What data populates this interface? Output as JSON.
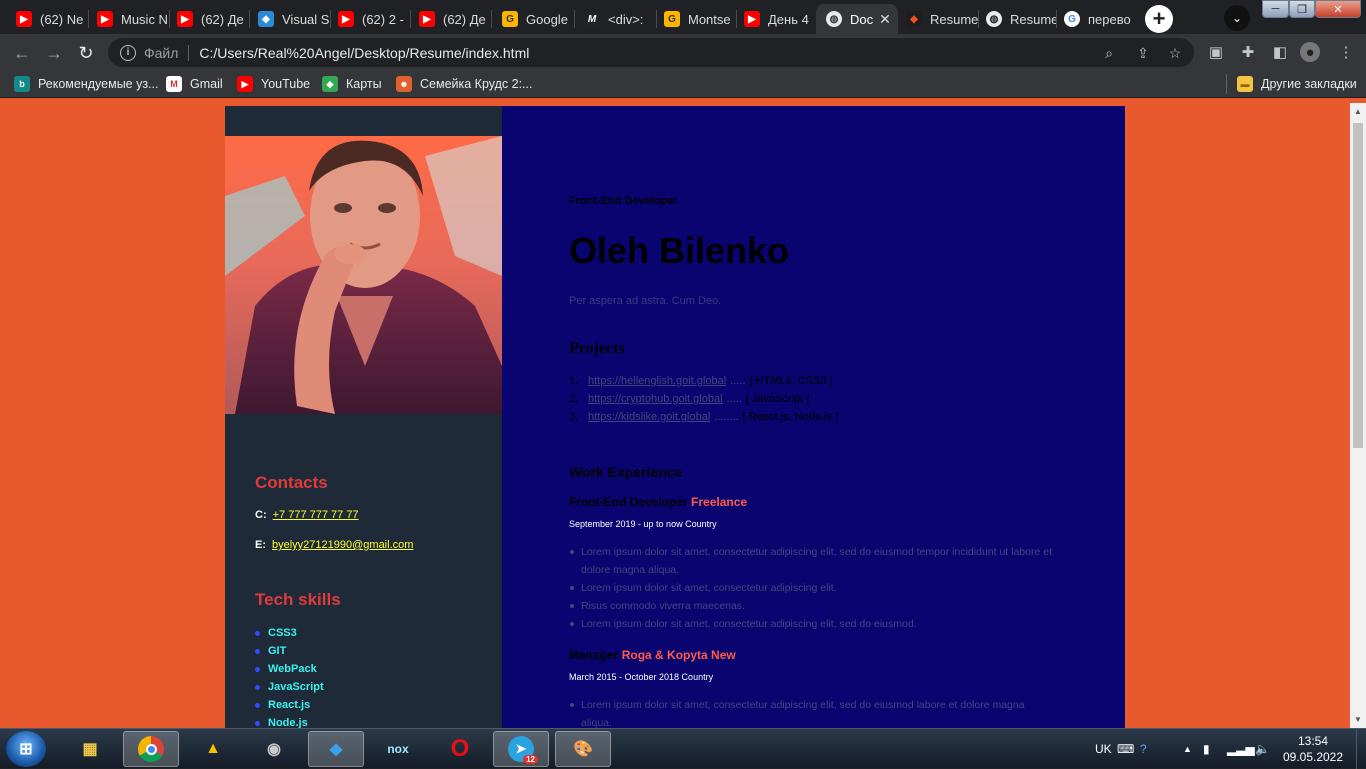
{
  "browser": {
    "tabs": [
      {
        "label": "(62) Ne",
        "icon": "youtube-icon"
      },
      {
        "label": "Music N",
        "icon": "youtube-icon"
      },
      {
        "label": "(62) Де",
        "icon": "youtube-icon"
      },
      {
        "label": "Visual S",
        "icon": "vscode-icon"
      },
      {
        "label": "(62) 2 -",
        "icon": "youtube-icon"
      },
      {
        "label": "(62) Де",
        "icon": "youtube-icon"
      },
      {
        "label": "Google",
        "icon": "goit-icon"
      },
      {
        "label": "<div>: ",
        "icon": "mdn-icon"
      },
      {
        "label": "Montse",
        "icon": "goit-icon"
      },
      {
        "label": "День 4",
        "icon": "youtube-icon"
      },
      {
        "label": "Doc",
        "icon": "globe-icon",
        "active": true
      },
      {
        "label": "Resume",
        "icon": "figma-icon"
      },
      {
        "label": "Resume",
        "icon": "globe-icon"
      },
      {
        "label": "перево",
        "icon": "google-icon"
      }
    ],
    "address": {
      "scheme": "Файл",
      "url": "C:/Users/Real%20Angel/Desktop/Resume/index.html"
    },
    "bookmarks": [
      {
        "label": "Рекомендуемые уз...",
        "icon": "bing-icon"
      },
      {
        "label": "Gmail",
        "icon": "gmail-icon"
      },
      {
        "label": "YouTube",
        "icon": "youtube-icon"
      },
      {
        "label": "Карты",
        "icon": "maps-icon"
      },
      {
        "label": "Семейка Крудс 2:...",
        "icon": "movie-icon"
      }
    ],
    "other_bookmarks": "Другие закладки"
  },
  "resume": {
    "subtitle": "Front-End Developer",
    "name": "Oleh Bilenko",
    "motto": "Per aspera ad astra. Cum Deo.",
    "projects_title": "Projects",
    "projects": [
      {
        "num": "1.",
        "url": "https://hellenglish.goit.global",
        "dots": ".....",
        "stack": "[ HTML5, CSS3 ]"
      },
      {
        "num": "2.",
        "url": "https://cryptohub.goit.global",
        "dots": ".....",
        "stack": "[ JavaScript ]"
      },
      {
        "num": "3.",
        "url": "https://kidslike.goit.global",
        "dots": "........",
        "stack": "[ React.js, Node.js ]"
      }
    ],
    "work_title": "Work Experience",
    "jobs": [
      {
        "role": "Front-End Developer",
        "company": "Freelance",
        "period": "September 2019 - up to now   Country",
        "bullets": [
          "Lorem ipsum dolor sit amet, consectetur adipiscing elit, sed do eiusmod tempor incididunt ut labore et dolore magna aliqua.",
          "Lorem ipsum dolor sit amet, consectetur adipiscing elit.",
          "Risus commodo viverra maecenas.",
          "Lorem ipsum dolor sit amet, consectetur adipiscing elit, sed do eiusmod."
        ]
      },
      {
        "role": "Manager",
        "company": "Roga & Kopyta New",
        "period": "March 2015 - October 2018   Country",
        "bullets": [
          "Lorem ipsum dolor sit amet, consectetur adipiscing elit, sed do eiusmod labore et dolore magna aliqua."
        ]
      }
    ],
    "contacts_title": "Contacts",
    "phone_label": "C:",
    "phone": "+7 777 777 77 77",
    "email_label": "E:",
    "email": "byelyy27121990@gmail.com",
    "skills_title": "Tech skills",
    "skills": [
      "CSS3",
      "GIT",
      "WebPack",
      "JavaScript",
      "React.js",
      "Node.js"
    ]
  },
  "taskbar": {
    "language": "UK",
    "time": "13:54",
    "date": "09.05.2022",
    "telegram_badge": "12"
  }
}
